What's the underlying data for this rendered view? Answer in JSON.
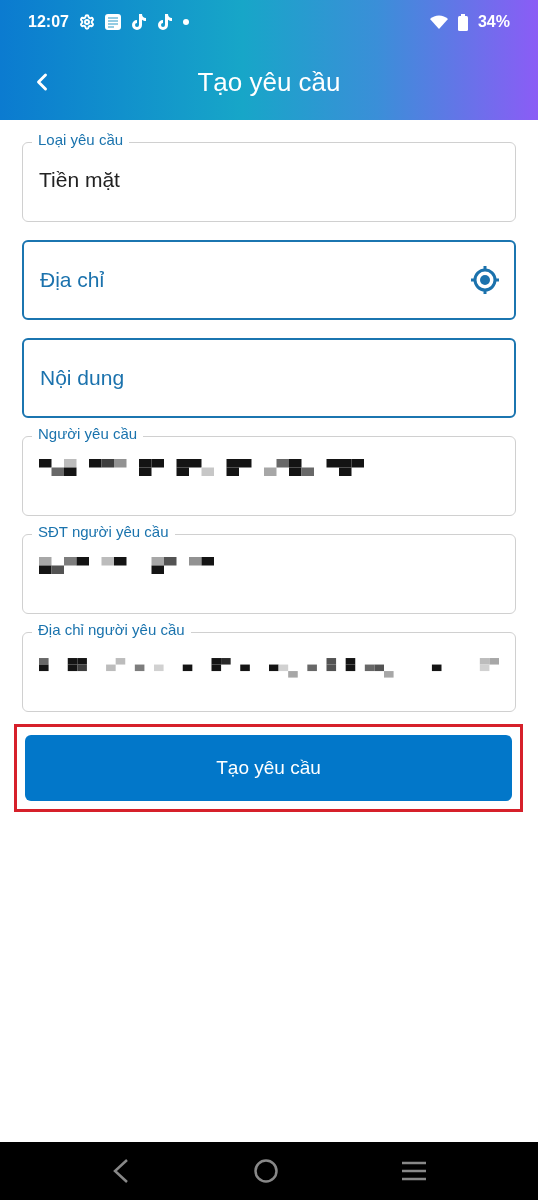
{
  "status_bar": {
    "time": "12:07",
    "battery": "34%"
  },
  "app_bar": {
    "title": "Tạo yêu cầu"
  },
  "fields": [
    {
      "kind": "select",
      "label": "Loại yêu cầu",
      "value": "Tiền mặt"
    },
    {
      "kind": "locate",
      "placeholder": "Địa chỉ"
    },
    {
      "kind": "input",
      "placeholder": "Nội dung"
    },
    {
      "kind": "redacted",
      "label": "Người yêu cầu"
    },
    {
      "kind": "redacted",
      "label": "SĐT người yêu cầu"
    },
    {
      "kind": "redacted",
      "label": "Địa chỉ người yêu cầu"
    }
  ],
  "submit_button": {
    "label": "Tạo yêu cầu",
    "highlighted": true
  }
}
